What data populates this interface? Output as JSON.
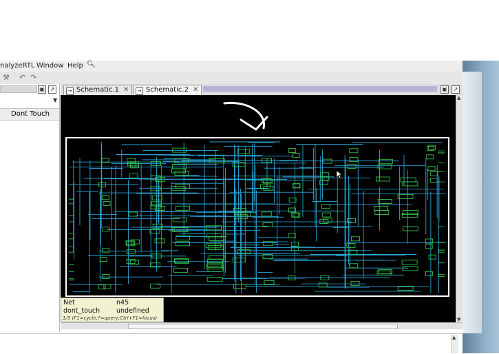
{
  "menu": {
    "analyze_label": "nalyzeRTL",
    "window_label": "Window",
    "help_label": "Help"
  },
  "left_panel": {
    "dont_touch_header": "Dont Touch"
  },
  "tabs": [
    {
      "label": "Schematic.1",
      "active": false
    },
    {
      "label": "Schematic.2",
      "active": true
    }
  ],
  "tooltip": {
    "net_label": "Net",
    "net_value": "n45",
    "dont_touch_label": "dont_touch",
    "dont_touch_value": "undefined",
    "hint": "1/3 (F1=cycle;?=query;Ctrl+F1=focus)"
  },
  "colors": {
    "canvas_bg": "#000000",
    "wire": "#2aa7d9",
    "cell": "#34c24a",
    "highlight_box": "#ffffff",
    "annotation": "#ffffff"
  },
  "icons": [
    "search-icon",
    "restore-icon",
    "maximize-icon",
    "close-icon",
    "schematic-tab-icon",
    "annotation-arrow"
  ]
}
